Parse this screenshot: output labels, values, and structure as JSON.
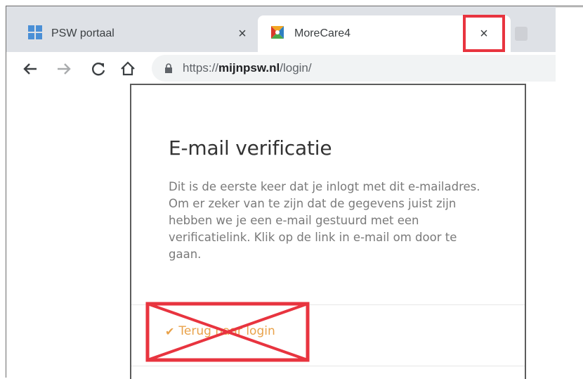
{
  "browser": {
    "tabs": [
      {
        "label": "PSW portaal",
        "icon": "windows-grid-icon",
        "active": false
      },
      {
        "label": "MoreCare4",
        "icon": "morecare-logo-icon",
        "active": true
      }
    ],
    "close_glyph": "×",
    "address": {
      "scheme": "https://",
      "domain": "mijnpsw.nl",
      "path": "/login/"
    }
  },
  "card": {
    "title": "E-mail verificatie",
    "body_lines": [
      "Dit is de eerste keer dat je inlogt met dit e-mailadres.",
      "Om er zeker van te zijn dat de gegevens juist zijn",
      "hebben we je een e-mail gestuurd met een",
      "verificatielink. Klik op de link in e-mail om door te",
      "gaan."
    ],
    "back_link": "Terug naar login"
  },
  "colors": {
    "annotation_red": "#e8343f",
    "link_orange": "#e9a24a",
    "tab_strip": "#dee1e6"
  }
}
